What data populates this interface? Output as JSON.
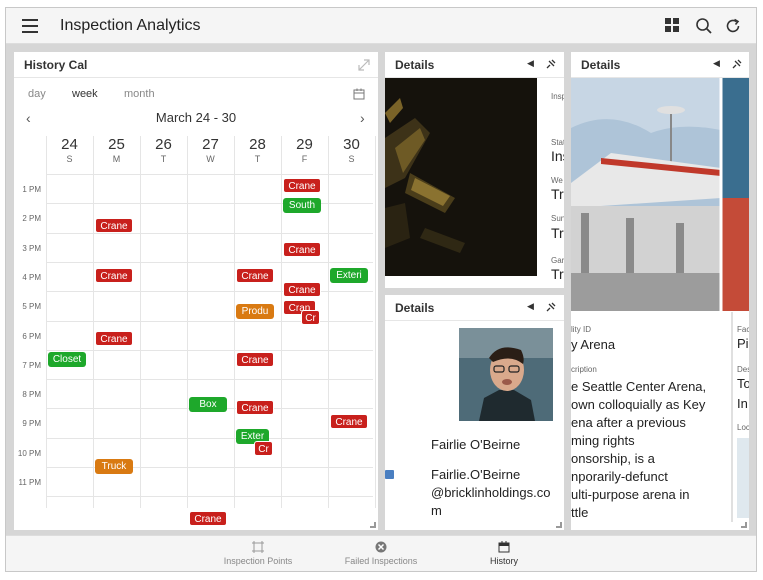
{
  "app": {
    "title": "Inspection Analytics",
    "icons": [
      "menu-icon",
      "grid-view-icon",
      "search-icon",
      "refresh-icon"
    ]
  },
  "calendar": {
    "title": "History Cal",
    "modes": [
      "day",
      "week",
      "month"
    ],
    "active_mode": "week",
    "range": "March 24 - 30",
    "days": [
      {
        "num": "24",
        "letter": "S"
      },
      {
        "num": "25",
        "letter": "M"
      },
      {
        "num": "26",
        "letter": "T"
      },
      {
        "num": "27",
        "letter": "W"
      },
      {
        "num": "28",
        "letter": "T"
      },
      {
        "num": "29",
        "letter": "F"
      },
      {
        "num": "30",
        "letter": "S"
      }
    ],
    "hours": [
      "1 PM",
      "2 PM",
      "3 PM",
      "4 PM",
      "5 PM",
      "6 PM",
      "7 PM",
      "8 PM",
      "9 PM",
      "10 PM",
      "11 PM"
    ],
    "events": [
      {
        "label": "Crane",
        "color": "red"
      },
      {
        "label": "South",
        "color": "green"
      },
      {
        "label": "Crane",
        "color": "red"
      },
      {
        "label": "Crane",
        "color": "red"
      },
      {
        "label": "Crane",
        "color": "red"
      },
      {
        "label": "Crane",
        "color": "red"
      },
      {
        "label": "Exteri",
        "color": "green"
      },
      {
        "label": "Crane",
        "color": "red"
      },
      {
        "label": "Produ",
        "color": "orange"
      },
      {
        "label": "Cran",
        "color": "red"
      },
      {
        "label": "Cr",
        "color": "red"
      },
      {
        "label": "Crane",
        "color": "red"
      },
      {
        "label": "Closet",
        "color": "green"
      },
      {
        "label": "Crane",
        "color": "red"
      },
      {
        "label": "Box",
        "color": "green"
      },
      {
        "label": "Crane",
        "color": "red"
      },
      {
        "label": "Crane",
        "color": "red"
      },
      {
        "label": "Exter",
        "color": "green"
      },
      {
        "label": "Cr",
        "color": "red"
      },
      {
        "label": "Truck",
        "color": "orange"
      },
      {
        "label": "Crane",
        "color": "red"
      }
    ]
  },
  "details_top": {
    "title": "Details",
    "cut_labels": [
      "Insp",
      "Stat",
      "We",
      "Sun",
      "Gar"
    ],
    "cut_values": [
      "Ins",
      "Tr",
      "Tr",
      "Tr"
    ]
  },
  "details_person": {
    "title": "Details",
    "name": "Fairlie O'Beirne",
    "email_lines": [
      "Fairlie.O'Beirne",
      "@bricklinholdings.co",
      "m"
    ]
  },
  "details_arena": {
    "title": "Details",
    "facility_label": "lity ID",
    "facility_value": "y Arena",
    "desc_label": "cription",
    "description_lines": [
      "e Seattle Center Arena,",
      "own colloquially as Key",
      "ena after a previous",
      "ming rights",
      "onsorship, is a",
      "nporarily-defunct",
      "ulti-purpose arena in",
      "ttle"
    ],
    "side_labels": [
      "Fac",
      "Des",
      "Loc"
    ],
    "side_values": [
      "Pi",
      "To",
      "In"
    ]
  },
  "footer": {
    "items": [
      {
        "label": "Inspection Points",
        "icon": "inspection-points-icon"
      },
      {
        "label": "Failed Inspections",
        "icon": "failed-inspections-icon"
      },
      {
        "label": "History",
        "icon": "history-calendar-icon"
      }
    ]
  }
}
